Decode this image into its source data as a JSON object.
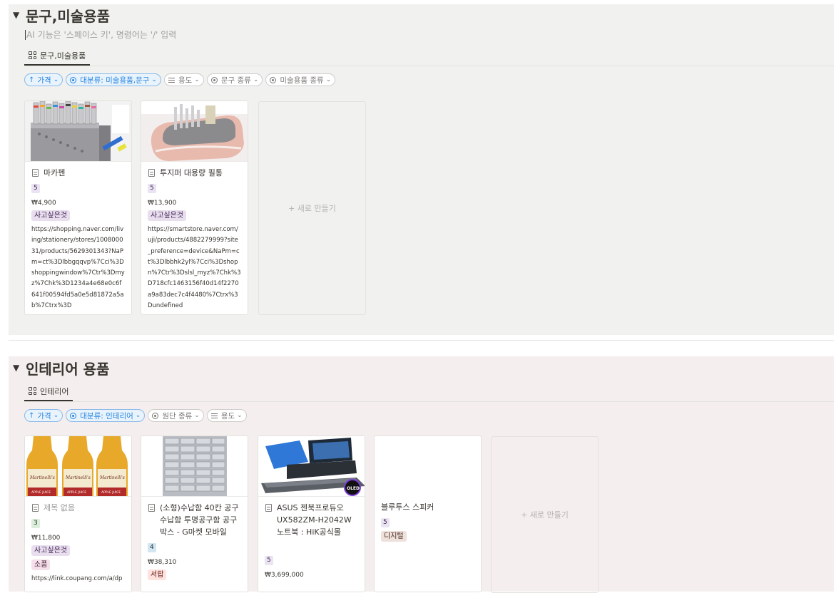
{
  "sections": [
    {
      "title": "문구,미술용품",
      "ai_hint": "AI 기능은 '스페이스 키', 명령어는 '/' 입력",
      "view_tab": "문구,미술용품",
      "filters": [
        "가격",
        "대분류: 미술용품,문구",
        "용도",
        "문구 종류",
        "미술용품 종류"
      ],
      "cards": [
        {
          "title": "마카펜",
          "rating": "5",
          "price": "₩4,900",
          "tags": [
            "사고싶은것"
          ],
          "url": "https://shopping.naver.com/living/stationery/stores/100800031/products/5629301343?NaPm=ct%3Dlbbgqqvp%7Cci%3Dshoppingwindow%7Ctr%3Dmyz%7Chk%3D1234a4e68e0c6f641f00594fd5a0e5d81872a5ab%7Ctrx%3D"
        },
        {
          "title": "투지퍼 대용량 필통",
          "rating": "5",
          "price": "₩13,900",
          "tags": [
            "사고싶은것"
          ],
          "url": "https://smartstore.naver.com/uji/products/4882279999?site_preference=device&NaPm=ct%3Dlbbhk2yl%7Cci%3Dshopn%7Ctr%3Dslsl_myz%7Chk%3D718cfc1463156f40d14f2270a9a83dec7c4f4480%7Ctrx%3Dundefined"
        }
      ],
      "new_label": "+ 새로 만들기"
    },
    {
      "title": "인테리어 용품",
      "view_tab": "인테리어",
      "filters": [
        "가격",
        "대분류: 인테리어",
        "원단 종류",
        "용도"
      ],
      "cards": [
        {
          "title": "제목 없음",
          "rating": "3",
          "price": "₩11,800",
          "tags": [
            "사고싶은것",
            "소품"
          ],
          "url": "https://link.coupang.com/a/dp"
        },
        {
          "title": "(소형)수납함 40칸 공구 수납함 투명공구함 공구박스 - G마켓 모바일",
          "rating": "4",
          "price": "₩38,310",
          "tags": [
            "서랍"
          ]
        },
        {
          "title": "ASUS 젠북프로듀오 UX582ZM-H2042W 노트북 : HiK공식몰",
          "rating": "5",
          "price": "₩3,699,000"
        },
        {
          "title": "블루투스 스피커",
          "rating": "5",
          "tags": [
            "디지털"
          ]
        }
      ],
      "new_label": "+ 새로 만들기"
    }
  ],
  "thumb_labels": {
    "juice_brand": "Martinelli's",
    "juice_sub": "APPLE JUICE",
    "oled": "OLED"
  },
  "colors": {
    "filter_active": "#2383e2",
    "section1_bg": "#f1f1ef",
    "section2_bg": "#f4eeee"
  }
}
